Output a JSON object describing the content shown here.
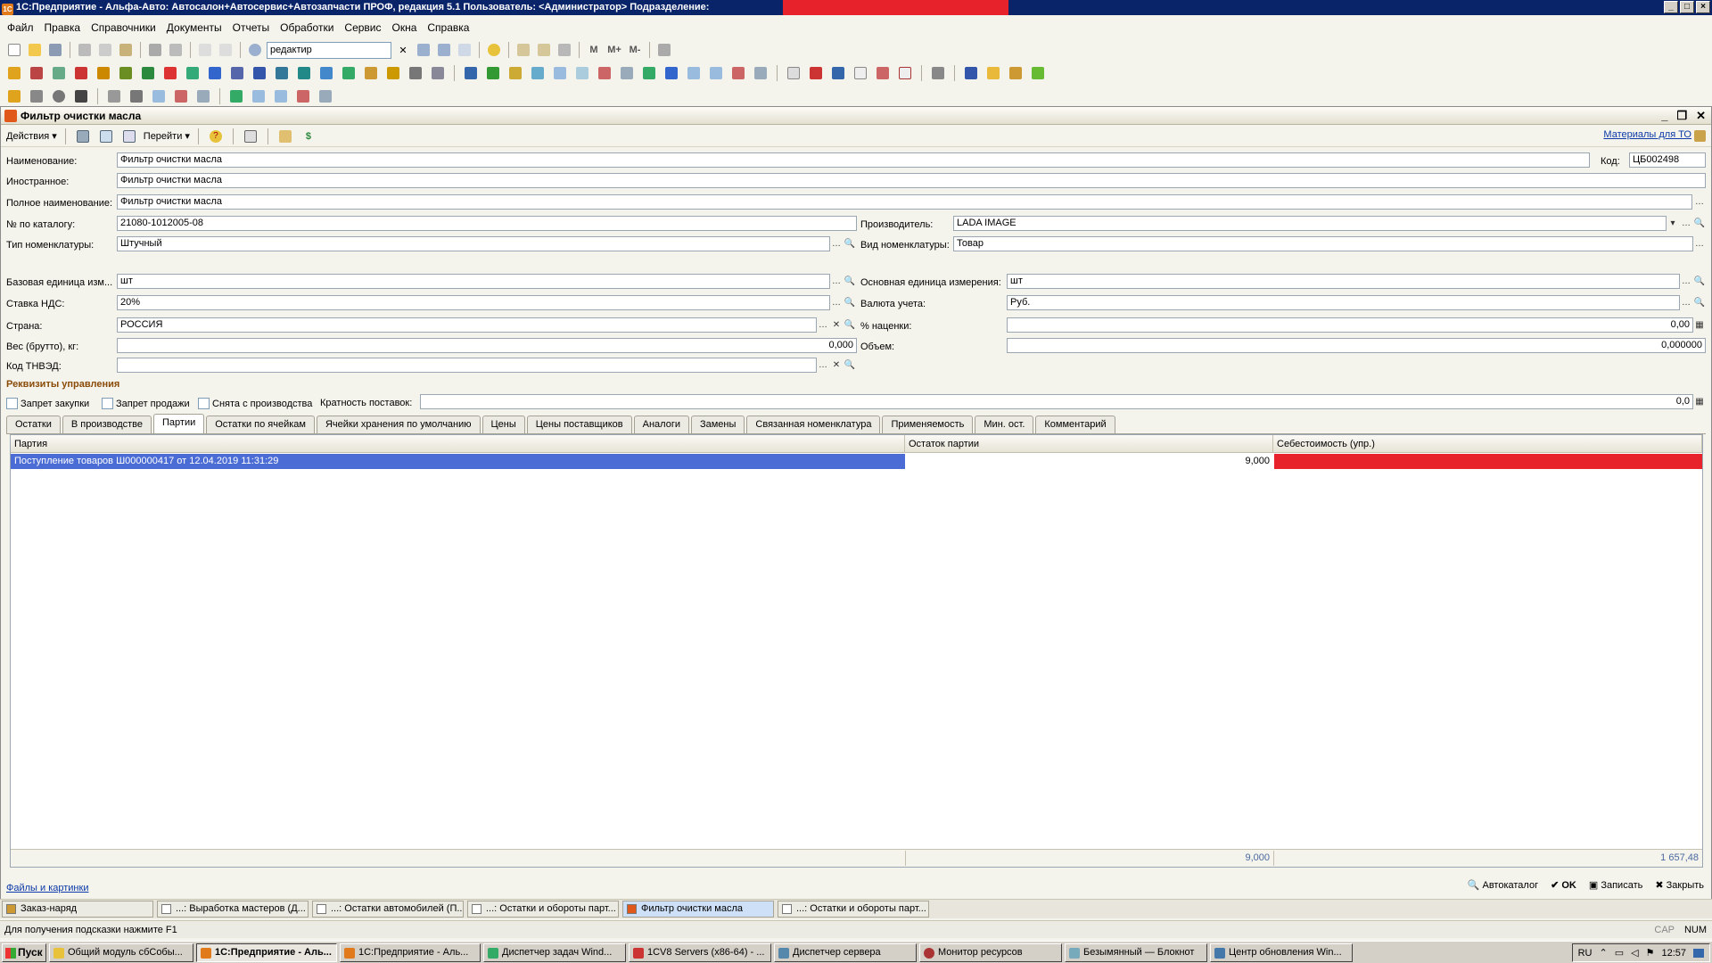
{
  "titlebar": {
    "text": "1С:Предприятие - Альфа-Авто: Автосалон+Автосервис+Автозапчасти ПРОФ, редакция 5.1   Пользователь: <Администратор>   Подразделение:",
    "app_icon": "1c-icon"
  },
  "menu": [
    "Файл",
    "Правка",
    "Справочники",
    "Документы",
    "Отчеты",
    "Обработки",
    "Сервис",
    "Окна",
    "Справка"
  ],
  "toolbar": {
    "search_value": "редактир",
    "memory_buttons": [
      "M",
      "M+",
      "M-"
    ]
  },
  "document": {
    "title": "Фильтр очистки масла",
    "actions_label": "Действия",
    "goto_label": "Перейти",
    "materials_link": "Материалы для ТО",
    "fields": {
      "name_label": "Наименование:",
      "name_value": "Фильтр очистки масла",
      "code_label": "Код:",
      "code_value": "ЦБ002498",
      "foreign_label": "Иностранное:",
      "foreign_value": "Фильтр очистки масла",
      "fullname_label": "Полное наименование:",
      "fullname_value": "Фильтр очистки масла",
      "catalog_label": "№ по каталогу:",
      "catalog_value": "21080-1012005-08",
      "manufacturer_label": "Производитель:",
      "manufacturer_value": "LADA IMAGE",
      "type_label": "Тип номенклатуры:",
      "type_value": "Штучный",
      "kind_label": "Вид номенклатуры:",
      "kind_value": "Товар",
      "base_unit_label": "Базовая единица изм...",
      "base_unit_value": "шт",
      "main_unit_label": "Основная единица измерения:",
      "main_unit_value": "шт",
      "vat_label": "Ставка НДС:",
      "vat_value": "20%",
      "currency_label": "Валюта учета:",
      "currency_value": "Руб.",
      "country_label": "Страна:",
      "country_value": "РОССИЯ",
      "markup_label": "% наценки:",
      "markup_value": "0,00",
      "weight_label": "Вес (брутто), кг:",
      "weight_value": "0,000",
      "volume_label": "Объем:",
      "volume_value": "0,000000",
      "tnved_label": "Код ТНВЭД:",
      "tnved_value": ""
    },
    "management_header": "Реквизиты управления",
    "checks": {
      "no_purchase": "Запрет закупки",
      "no_sale": "Запрет продажи",
      "discontinued": "Снята с производства",
      "multiplicity_label": "Кратность поставок:",
      "multiplicity_value": "0,0"
    },
    "tabs": [
      "Остатки",
      "В производстве",
      "Партии",
      "Остатки по ячейкам",
      "Ячейки хранения по умолчанию",
      "Цены",
      "Цены поставщиков",
      "Аналоги",
      "Замены",
      "Связанная номенклатура",
      "Применяемость",
      "Мин. ост.",
      "Комментарий"
    ],
    "active_tab": "Партии",
    "table": {
      "columns": [
        "Партия",
        "Остаток партии",
        "Себестоимость (упр.)"
      ],
      "rows": [
        {
          "batch": "Поступление товаров Ш000000417 от 12.04.2019 11:31:29",
          "rest": "9,000",
          "cost": ""
        }
      ],
      "totals": {
        "rest": "9,000",
        "cost": "1 657,48"
      }
    },
    "footer": {
      "files_link": "Файлы и картинки",
      "autocatalog": "Автокаталог",
      "ok": "OK",
      "save": "Записать",
      "close": "Закрыть"
    }
  },
  "window_tabs": [
    "Заказ-наряд",
    "...: Выработка мастеров (Д...",
    "...: Остатки автомобилей (П...",
    "...: Остатки и обороты парт...",
    "Фильтр очистки масла",
    "...: Остатки и обороты парт..."
  ],
  "status": {
    "hint": "Для получения подсказки нажмите F1",
    "cap": "CAP",
    "num": "NUM"
  },
  "taskbar": {
    "start": "Пуск",
    "tasks": [
      "Общий модуль сбСобы...",
      "1С:Предприятие - Аль...",
      "1С:Предприятие - Аль...",
      "Диспетчер задач Wind...",
      "1CV8 Servers (x86-64) - ...",
      "Диспетчер сервера",
      "Монитор ресурсов",
      "Безымянный — Блокнот",
      "Центр обновления Win..."
    ],
    "lang": "RU",
    "clock": "12:57"
  },
  "colors": {
    "selection": "#4a6cd4",
    "cost_cell": "#e7222b",
    "title": "#0a246a"
  }
}
